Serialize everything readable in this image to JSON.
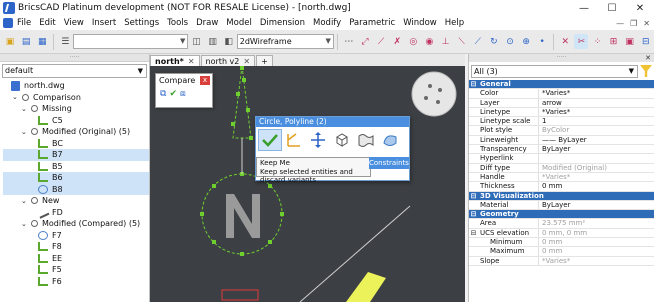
{
  "window": {
    "title": "BricsCAD Platinum development (NOT FOR RESALE License) - [north.dwg]",
    "controls": [
      "—",
      "☐",
      "✕"
    ]
  },
  "menu": {
    "items": [
      "File",
      "Edit",
      "View",
      "Insert",
      "Settings",
      "Tools",
      "Draw",
      "Model",
      "Dimension",
      "Modify",
      "Parametric",
      "Window",
      "Help"
    ],
    "right": [
      "—",
      "❐",
      "✕"
    ]
  },
  "toolbar": {
    "visual_style": "2dWireframe"
  },
  "left": {
    "filter": "default",
    "tree": [
      {
        "label": "north.dwg",
        "level": 0,
        "icon": "file",
        "chev": ""
      },
      {
        "label": "Comparison",
        "level": 1,
        "icon": "dot",
        "chev": "v"
      },
      {
        "label": "Missing",
        "level": 2,
        "icon": "dot",
        "chev": "v"
      },
      {
        "label": "C5",
        "level": 3,
        "icon": "poly",
        "chev": ""
      },
      {
        "label": "Modified (Original) (5)",
        "level": 2,
        "icon": "dot",
        "chev": "v"
      },
      {
        "label": "BC",
        "level": 3,
        "icon": "poly",
        "chev": ""
      },
      {
        "label": "B7",
        "level": 3,
        "icon": "poly",
        "chev": "",
        "sel": true
      },
      {
        "label": "B5",
        "level": 3,
        "icon": "poly",
        "chev": ""
      },
      {
        "label": "B6",
        "level": 3,
        "icon": "poly",
        "chev": "",
        "sel": true
      },
      {
        "label": "B8",
        "level": 3,
        "icon": "circ",
        "chev": "",
        "sel": true
      },
      {
        "label": "New",
        "level": 2,
        "icon": "dot",
        "chev": "v"
      },
      {
        "label": "FD",
        "level": 3,
        "icon": "line",
        "chev": ""
      },
      {
        "label": "Modified (Compared) (5)",
        "level": 2,
        "icon": "dot",
        "chev": "v"
      },
      {
        "label": "F7",
        "level": 3,
        "icon": "circ",
        "chev": ""
      },
      {
        "label": "F8",
        "level": 3,
        "icon": "poly",
        "chev": ""
      },
      {
        "label": "EE",
        "level": 3,
        "icon": "poly",
        "chev": ""
      },
      {
        "label": "F5",
        "level": 3,
        "icon": "poly",
        "chev": ""
      },
      {
        "label": "F6",
        "level": 3,
        "icon": "poly",
        "chev": ""
      }
    ]
  },
  "compare": {
    "title": "Compare",
    "close": "x"
  },
  "tabs": [
    {
      "label": "north*",
      "active": true
    },
    {
      "label": "north v2",
      "active": false
    },
    {
      "label": "+",
      "active": false
    }
  ],
  "quad": {
    "header": "Circle, Polyline (2)",
    "tip_title": "Keep Me",
    "tip_desc": "Keep selected entities and discard variants",
    "constraints": "Constraints"
  },
  "properties": {
    "selection": "All (3)",
    "rows": [
      {
        "type": "cat",
        "name": "General",
        "value": ""
      },
      {
        "type": "prop",
        "name": "Color",
        "value": "*Varies*"
      },
      {
        "type": "prop",
        "name": "Layer",
        "value": "arrow"
      },
      {
        "type": "prop",
        "name": "Linetype",
        "value": "*Varies*"
      },
      {
        "type": "prop",
        "name": "Linetype scale",
        "value": "1"
      },
      {
        "type": "prop",
        "name": "Plot style",
        "value": "ByColor",
        "grey": true
      },
      {
        "type": "prop",
        "name": "Lineweight",
        "value": "—— ByLayer"
      },
      {
        "type": "prop",
        "name": "Transparency",
        "value": "ByLayer"
      },
      {
        "type": "prop",
        "name": "Hyperlink",
        "value": ""
      },
      {
        "type": "prop",
        "name": "Diff type",
        "value": "Modified (Original)",
        "grey": true
      },
      {
        "type": "prop",
        "name": "Handle",
        "value": "*Varies*",
        "grey": true
      },
      {
        "type": "prop",
        "name": "Thickness",
        "value": "0 mm"
      },
      {
        "type": "cat",
        "name": "3D Visualization",
        "value": ""
      },
      {
        "type": "prop",
        "name": "Material",
        "value": "ByLayer"
      },
      {
        "type": "cat",
        "name": "Geometry",
        "value": ""
      },
      {
        "type": "prop",
        "name": "Area",
        "value": "23.575 mm²",
        "grey": true
      },
      {
        "type": "prop",
        "name": "UCS elevation",
        "value": "0 mm, 0 mm",
        "grey": true,
        "exp": "⊟"
      },
      {
        "type": "prop",
        "name": "Minimum",
        "value": "0 mm",
        "grey": true,
        "indent": true
      },
      {
        "type": "prop",
        "name": "Maximum",
        "value": "0 mm",
        "grey": true,
        "indent": true
      },
      {
        "type": "prop",
        "name": "Slope",
        "value": "*Varies*",
        "grey": true
      }
    ]
  },
  "colors": {
    "accent": "#4a8fdf",
    "selection": "#cfe3f8",
    "category": "#2f6cb8",
    "viewport": "#3c3f43",
    "entity": "#6fcf2f"
  }
}
